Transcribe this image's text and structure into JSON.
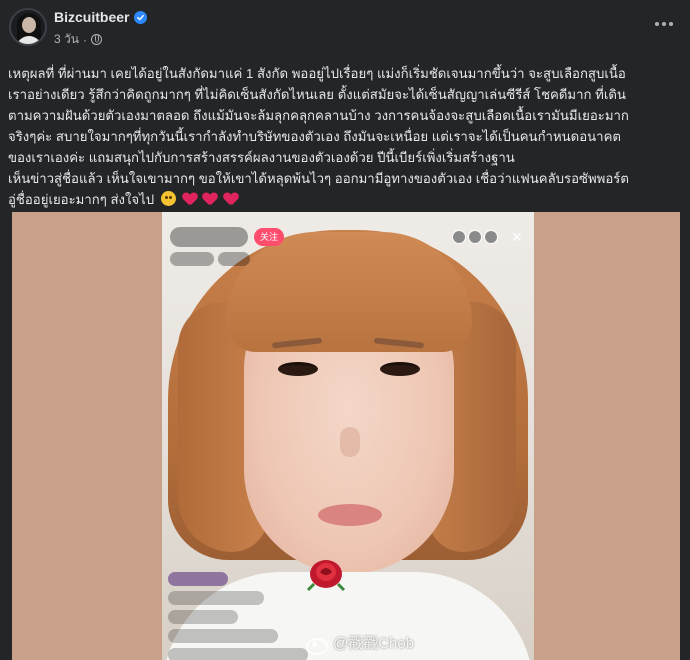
{
  "post": {
    "author": "Bizcuitbeer",
    "time": "3 วัน",
    "privacy_icon": "globe-icon",
    "verified_color": "#2d88ff",
    "caption_lines": [
      "เหตุผลที่ ที่ผ่านมา เคยได้อยู่ในสังกัดมาแค่ 1 สังกัด พออยู่ไปเรื่อยๆ แม่งก็เริ่มชัดเจนมากขึ้นว่า จะสูบเลือกสูบเนื้อ",
      "เราอย่างเดียว รู้สึกว่าคิดถูกมากๆ ที่ไม่คิดเซ็นสังกัดไหนเลย ตั้งแต่สมัยจะได้เซ็นสัญญาเล่นซีรีส์ โชคดีมาก ที่เดิน",
      "ตามความฝันด้วยตัวเองมาตลอด ถึงแม้มันจะล้มลุกคลุกคลานบ้าง วงการคนจ้องจะสูบเลือดเนื้อเรามันมีเยอะมาก",
      "จริงๆค่ะ สบายใจมากๆที่ทุกวันนี้เรากำลังทำบริษัทของตัวเอง ถึงมันจะเหนื่อย แต่เราจะได้เป็นคนกำหนดอนาคต",
      "ของเราเองค่ะ แถมสนุกไปกับการสร้างสรรค์ผลงานของตัวเองด้วย ปีนี้เบียร์เพิ่งเริ่มสร้างฐาน",
      "เห็นข่าวสู่ชื่อแล้ว เห็นใจเขามากๆ ขอให้เขาได้หลุดพ้นไวๆ ออกมามีอูทางของตัวเอง เชื่อว่าแฟนคลับรอซัพพอร์ต",
      "อู่ชื่ออยู่เยอะมากๆ ส่งใจไป"
    ],
    "emoji_tail": [
      "pleading-face-emoji",
      "heart-emoji",
      "heart-emoji",
      "heart-emoji"
    ],
    "live_button": "关注",
    "watermark": "@戳戳Chob"
  }
}
